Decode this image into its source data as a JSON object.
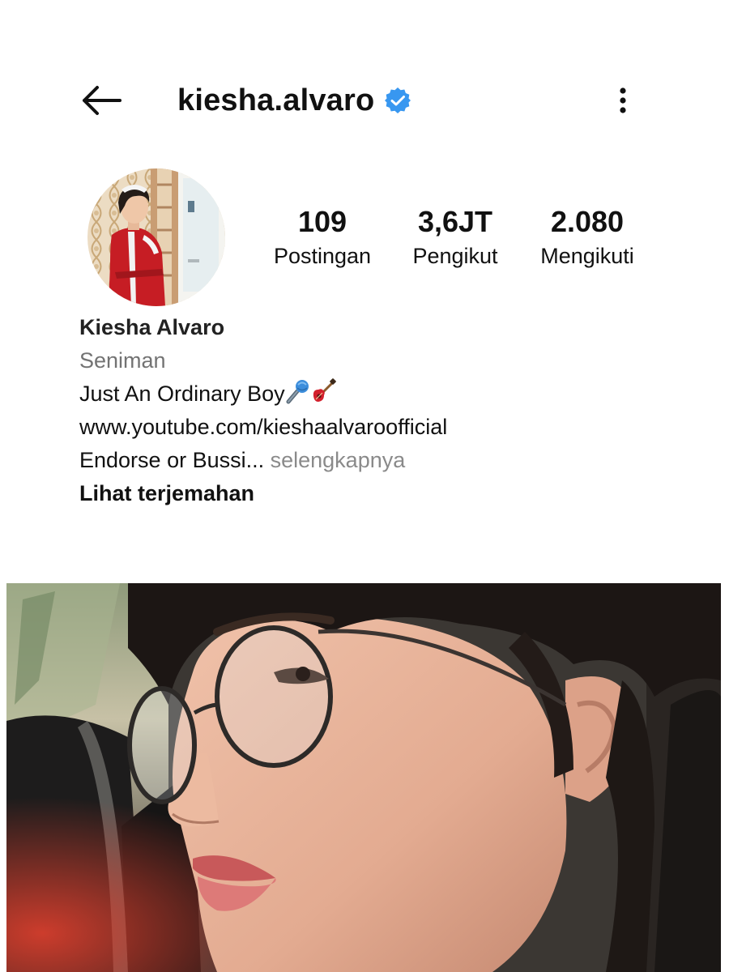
{
  "header": {
    "username": "kiesha.alvaro",
    "back_icon": "arrow-left-icon",
    "verified_icon": "verified-badge-icon",
    "more_icon": "more-vertical-icon"
  },
  "stats": {
    "posts": {
      "value": "109",
      "label": "Postingan"
    },
    "followers": {
      "value": "3,6JT",
      "label": "Pengikut"
    },
    "following": {
      "value": "2.080",
      "label": "Mengikuti"
    }
  },
  "bio": {
    "name": "Kiesha Alvaro",
    "category": "Seniman",
    "tagline": "Just An Ordinary Boy",
    "tagline_icons": [
      "microphone-icon",
      "guitar-icon"
    ],
    "link": "www.youtube.com/kieshaalvaroofficial",
    "truncated_text": "Endorse or Bussi...",
    "see_more": " selengkapnya",
    "translate": "Lihat terjemahan"
  },
  "colors": {
    "verified_blue": "#3897f0",
    "text_primary": "#111111",
    "text_secondary": "#737373"
  }
}
